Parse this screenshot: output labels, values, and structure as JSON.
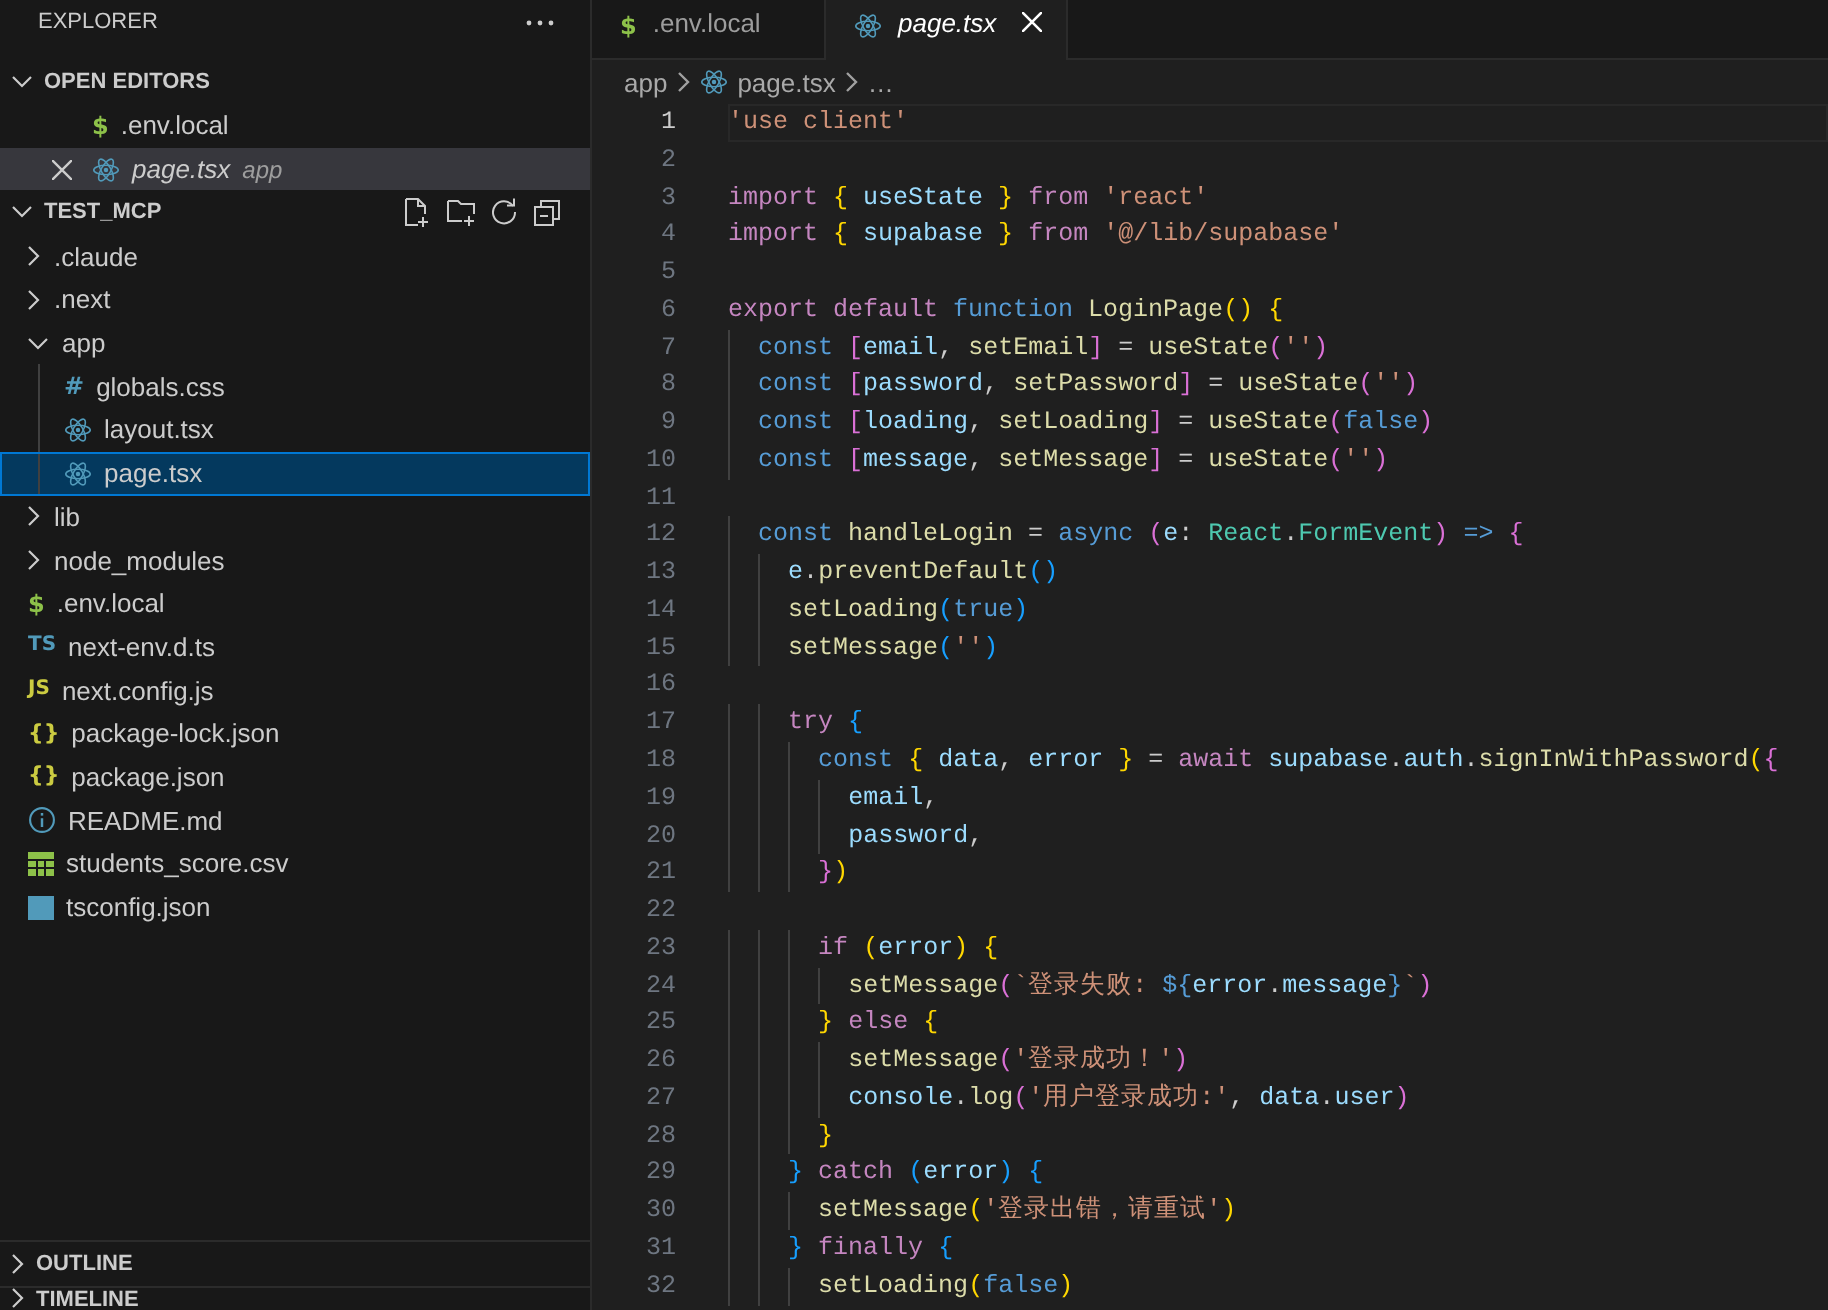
{
  "sidebar": {
    "title": "EXPLORER",
    "sections": [
      {
        "title": "OPEN EDITORS",
        "expanded": true,
        "kind": "editors",
        "items": [
          {
            "label": ".env.local",
            "kind": "env",
            "glyph": "$",
            "preview": false,
            "selected": false
          },
          {
            "label": "page.tsx",
            "kind": "react",
            "description": "app",
            "preview": true,
            "selected": true
          }
        ]
      },
      {
        "title": "TEST_MCP",
        "expanded": true,
        "kind": "tree",
        "items": [
          {
            "label": ".claude",
            "kind": "folder",
            "expanded": false,
            "selected": false
          },
          {
            "label": ".next",
            "kind": "folder",
            "expanded": false,
            "selected": false
          },
          {
            "label": "app",
            "kind": "folder",
            "expanded": true,
            "selected": false,
            "children": [
              {
                "label": "globals.css",
                "kind": "css",
                "glyph": "#",
                "selected": false
              },
              {
                "label": "layout.tsx",
                "kind": "react",
                "selected": false
              },
              {
                "label": "page.tsx",
                "kind": "react",
                "selected": true
              }
            ]
          },
          {
            "label": "lib",
            "kind": "folder",
            "expanded": false,
            "selected": false
          },
          {
            "label": "node_modules",
            "kind": "folder",
            "expanded": false,
            "selected": false
          },
          {
            "label": ".env.local",
            "kind": "env",
            "glyph": "$",
            "selected": false
          },
          {
            "label": "next-env.d.ts",
            "kind": "ts",
            "glyph": "TS",
            "selected": false
          },
          {
            "label": "next.config.js",
            "kind": "js",
            "glyph": "JS",
            "selected": false
          },
          {
            "label": "package-lock.json",
            "kind": "json",
            "glyph": "{}",
            "selected": false
          },
          {
            "label": "package.json",
            "kind": "json",
            "glyph": "{}",
            "selected": false
          },
          {
            "label": "README.md",
            "kind": "info",
            "selected": false
          },
          {
            "label": "students_score.csv",
            "kind": "table",
            "selected": false
          },
          {
            "label": "tsconfig.json",
            "kind": "tsconfig",
            "selected": false
          }
        ]
      },
      {
        "title": "OUTLINE",
        "expanded": false,
        "kind": "panel"
      },
      {
        "title": "TIMELINE",
        "expanded": false,
        "kind": "panel"
      }
    ]
  },
  "tabs": [
    {
      "label": ".env.local",
      "kind": "env",
      "glyph": "$",
      "preview": false,
      "selected": false
    },
    {
      "label": "page.tsx",
      "kind": "react",
      "preview": true,
      "selected": true
    }
  ],
  "breadcrumbs": [
    {
      "label": "app"
    },
    {
      "label": "page.tsx",
      "kind": "react"
    },
    {
      "label": "…"
    }
  ],
  "lines": [
    {
      "number": "1",
      "current": true,
      "tokens": [
        {
          "kind": "str",
          "text": "'use client'"
        }
      ]
    },
    {
      "number": "2",
      "current": false
    },
    {
      "number": "3",
      "current": false,
      "tokens": [
        {
          "kind": "k",
          "text": "import"
        },
        {
          "kind": "b1",
          "text": " {"
        },
        {
          "kind": "v",
          "text": " useState"
        },
        {
          "kind": "b1",
          "text": " }"
        },
        {
          "kind": "k",
          "text": " from"
        },
        {
          "kind": "str",
          "text": " 'react'"
        }
      ]
    },
    {
      "number": "4",
      "current": false,
      "tokens": [
        {
          "kind": "k",
          "text": "import"
        },
        {
          "kind": "b1",
          "text": " {"
        },
        {
          "kind": "v",
          "text": " supabase"
        },
        {
          "kind": "b1",
          "text": " }"
        },
        {
          "kind": "k",
          "text": " from"
        },
        {
          "kind": "str",
          "text": " '@/lib/supabase'"
        }
      ]
    },
    {
      "number": "5",
      "current": false
    },
    {
      "number": "6",
      "current": false,
      "tokens": [
        {
          "kind": "k",
          "text": "export"
        },
        {
          "kind": "k",
          "text": " default"
        },
        {
          "kind": "s",
          "text": " function"
        },
        {
          "kind": "f",
          "text": " LoginPage"
        },
        {
          "kind": "b1",
          "text": "()"
        },
        {
          "kind": "b1",
          "text": " {"
        }
      ]
    },
    {
      "number": "7",
      "current": false,
      "tokens": [
        {
          "kind": "s",
          "text": "  const"
        },
        {
          "kind": "b2",
          "text": " ["
        },
        {
          "kind": "v",
          "text": "email"
        },
        {
          "kind": "p",
          "text": ","
        },
        {
          "kind": "f",
          "text": " setEmail"
        },
        {
          "kind": "b2",
          "text": "]"
        },
        {
          "kind": "p",
          "text": " ="
        },
        {
          "kind": "f",
          "text": " useState"
        },
        {
          "kind": "b2",
          "text": "("
        },
        {
          "kind": "str",
          "text": "''"
        },
        {
          "kind": "b2",
          "text": ")"
        }
      ]
    },
    {
      "number": "8",
      "current": false,
      "tokens": [
        {
          "kind": "s",
          "text": "  const"
        },
        {
          "kind": "b2",
          "text": " ["
        },
        {
          "kind": "v",
          "text": "password"
        },
        {
          "kind": "p",
          "text": ","
        },
        {
          "kind": "f",
          "text": " setPassword"
        },
        {
          "kind": "b2",
          "text": "]"
        },
        {
          "kind": "p",
          "text": " ="
        },
        {
          "kind": "f",
          "text": " useState"
        },
        {
          "kind": "b2",
          "text": "("
        },
        {
          "kind": "str",
          "text": "''"
        },
        {
          "kind": "b2",
          "text": ")"
        }
      ]
    },
    {
      "number": "9",
      "current": false,
      "tokens": [
        {
          "kind": "s",
          "text": "  const"
        },
        {
          "kind": "b2",
          "text": " ["
        },
        {
          "kind": "v",
          "text": "loading"
        },
        {
          "kind": "p",
          "text": ","
        },
        {
          "kind": "f",
          "text": " setLoading"
        },
        {
          "kind": "b2",
          "text": "]"
        },
        {
          "kind": "p",
          "text": " ="
        },
        {
          "kind": "f",
          "text": " useState"
        },
        {
          "kind": "b2",
          "text": "("
        },
        {
          "kind": "s",
          "text": "false"
        },
        {
          "kind": "b2",
          "text": ")"
        }
      ]
    },
    {
      "number": "10",
      "current": false,
      "tokens": [
        {
          "kind": "s",
          "text": "  const"
        },
        {
          "kind": "b2",
          "text": " ["
        },
        {
          "kind": "v",
          "text": "message"
        },
        {
          "kind": "p",
          "text": ","
        },
        {
          "kind": "f",
          "text": " setMessage"
        },
        {
          "kind": "b2",
          "text": "]"
        },
        {
          "kind": "p",
          "text": " ="
        },
        {
          "kind": "f",
          "text": " useState"
        },
        {
          "kind": "b2",
          "text": "("
        },
        {
          "kind": "str",
          "text": "''"
        },
        {
          "kind": "b2",
          "text": ")"
        }
      ]
    },
    {
      "number": "11",
      "current": false
    },
    {
      "number": "12",
      "current": false,
      "tokens": [
        {
          "kind": "s",
          "text": "  const"
        },
        {
          "kind": "f",
          "text": " handleLogin"
        },
        {
          "kind": "p",
          "text": " ="
        },
        {
          "kind": "s",
          "text": " async"
        },
        {
          "kind": "b2",
          "text": " ("
        },
        {
          "kind": "v",
          "text": "e"
        },
        {
          "kind": "p",
          "text": ":"
        },
        {
          "kind": "t",
          "text": " React"
        },
        {
          "kind": "p",
          "text": "."
        },
        {
          "kind": "t",
          "text": "FormEvent"
        },
        {
          "kind": "b2",
          "text": ")"
        },
        {
          "kind": "s",
          "text": " =>"
        },
        {
          "kind": "b2",
          "text": " {"
        }
      ]
    },
    {
      "number": "13",
      "current": false,
      "tokens": [
        {
          "kind": "v",
          "text": "    e"
        },
        {
          "kind": "p",
          "text": "."
        },
        {
          "kind": "f",
          "text": "preventDefault"
        },
        {
          "kind": "b3",
          "text": "()"
        }
      ]
    },
    {
      "number": "14",
      "current": false,
      "tokens": [
        {
          "kind": "f",
          "text": "    setLoading"
        },
        {
          "kind": "b3",
          "text": "("
        },
        {
          "kind": "s",
          "text": "true"
        },
        {
          "kind": "b3",
          "text": ")"
        }
      ]
    },
    {
      "number": "15",
      "current": false,
      "tokens": [
        {
          "kind": "f",
          "text": "    setMessage"
        },
        {
          "kind": "b3",
          "text": "("
        },
        {
          "kind": "str",
          "text": "''"
        },
        {
          "kind": "b3",
          "text": ")"
        }
      ]
    },
    {
      "number": "16",
      "current": false
    },
    {
      "number": "17",
      "current": false,
      "tokens": [
        {
          "kind": "k",
          "text": "    try"
        },
        {
          "kind": "b3",
          "text": " {"
        }
      ]
    },
    {
      "number": "18",
      "current": false,
      "tokens": [
        {
          "kind": "s",
          "text": "      const"
        },
        {
          "kind": "b1",
          "text": " {"
        },
        {
          "kind": "v",
          "text": " data"
        },
        {
          "kind": "p",
          "text": ","
        },
        {
          "kind": "v",
          "text": " error"
        },
        {
          "kind": "b1",
          "text": " }"
        },
        {
          "kind": "p",
          "text": " ="
        },
        {
          "kind": "k",
          "text": " await"
        },
        {
          "kind": "v",
          "text": " supabase"
        },
        {
          "kind": "p",
          "text": "."
        },
        {
          "kind": "v",
          "text": "auth"
        },
        {
          "kind": "p",
          "text": "."
        },
        {
          "kind": "f",
          "text": "signInWithPassword"
        },
        {
          "kind": "b1",
          "text": "("
        },
        {
          "kind": "b2",
          "text": "{"
        }
      ]
    },
    {
      "number": "19",
      "current": false,
      "tokens": [
        {
          "kind": "v",
          "text": "        email"
        },
        {
          "kind": "p",
          "text": ","
        }
      ]
    },
    {
      "number": "20",
      "current": false,
      "tokens": [
        {
          "kind": "v",
          "text": "        password"
        },
        {
          "kind": "p",
          "text": ","
        }
      ]
    },
    {
      "number": "21",
      "current": false,
      "tokens": [
        {
          "kind": "b2",
          "text": "      }"
        },
        {
          "kind": "b1",
          "text": ")"
        }
      ]
    },
    {
      "number": "22",
      "current": false
    },
    {
      "number": "23",
      "current": false,
      "tokens": [
        {
          "kind": "k",
          "text": "      if"
        },
        {
          "kind": "b1",
          "text": " ("
        },
        {
          "kind": "v",
          "text": "error"
        },
        {
          "kind": "b1",
          "text": ")"
        },
        {
          "kind": "b1",
          "text": " {"
        }
      ]
    },
    {
      "number": "24",
      "current": false,
      "tokens": [
        {
          "kind": "f",
          "text": "        setMessage"
        },
        {
          "kind": "b2",
          "text": "("
        },
        {
          "kind": "str",
          "text": "`登录失败: "
        },
        {
          "kind": "s",
          "text": "${"
        },
        {
          "kind": "v",
          "text": "error"
        },
        {
          "kind": "p",
          "text": "."
        },
        {
          "kind": "v",
          "text": "message"
        },
        {
          "kind": "s",
          "text": "}"
        },
        {
          "kind": "str",
          "text": "`"
        },
        {
          "kind": "b2",
          "text": ")"
        }
      ]
    },
    {
      "number": "25",
      "current": false,
      "tokens": [
        {
          "kind": "b1",
          "text": "      }"
        },
        {
          "kind": "k",
          "text": " else"
        },
        {
          "kind": "b1",
          "text": " {"
        }
      ]
    },
    {
      "number": "26",
      "current": false,
      "tokens": [
        {
          "kind": "f",
          "text": "        setMessage"
        },
        {
          "kind": "b2",
          "text": "("
        },
        {
          "kind": "str",
          "text": "'登录成功！'"
        },
        {
          "kind": "b2",
          "text": ")"
        }
      ]
    },
    {
      "number": "27",
      "current": false,
      "tokens": [
        {
          "kind": "v",
          "text": "        console"
        },
        {
          "kind": "p",
          "text": "."
        },
        {
          "kind": "f",
          "text": "log"
        },
        {
          "kind": "b2",
          "text": "("
        },
        {
          "kind": "str",
          "text": "'用户登录成功:'"
        },
        {
          "kind": "p",
          "text": ","
        },
        {
          "kind": "v",
          "text": " data"
        },
        {
          "kind": "p",
          "text": "."
        },
        {
          "kind": "v",
          "text": "user"
        },
        {
          "kind": "b2",
          "text": ")"
        }
      ]
    },
    {
      "number": "28",
      "current": false,
      "tokens": [
        {
          "kind": "b1",
          "text": "      }"
        }
      ]
    },
    {
      "number": "29",
      "current": false,
      "tokens": [
        {
          "kind": "b3",
          "text": "    }"
        },
        {
          "kind": "k",
          "text": " catch"
        },
        {
          "kind": "b3",
          "text": " ("
        },
        {
          "kind": "v",
          "text": "error"
        },
        {
          "kind": "b3",
          "text": ")"
        },
        {
          "kind": "b3",
          "text": " {"
        }
      ]
    },
    {
      "number": "30",
      "current": false,
      "tokens": [
        {
          "kind": "f",
          "text": "      setMessage"
        },
        {
          "kind": "b1",
          "text": "("
        },
        {
          "kind": "str",
          "text": "'登录出错，请重试'"
        },
        {
          "kind": "b1",
          "text": ")"
        }
      ]
    },
    {
      "number": "31",
      "current": false,
      "tokens": [
        {
          "kind": "b3",
          "text": "    }"
        },
        {
          "kind": "k",
          "text": " finally"
        },
        {
          "kind": "b3",
          "text": " {"
        }
      ]
    },
    {
      "number": "32",
      "current": false,
      "tokens": [
        {
          "kind": "f",
          "text": "      setLoading"
        },
        {
          "kind": "b1",
          "text": "("
        },
        {
          "kind": "s",
          "text": "false"
        },
        {
          "kind": "b1",
          "text": ")"
        }
      ]
    }
  ]
}
